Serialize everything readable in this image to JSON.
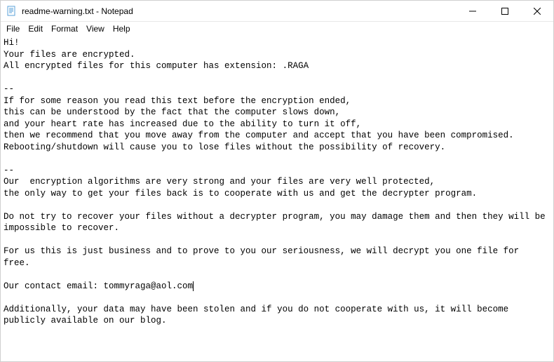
{
  "window": {
    "title": "readme-warning.txt - Notepad",
    "icon": "notepad-icon"
  },
  "menu": {
    "items": [
      "File",
      "Edit",
      "Format",
      "View",
      "Help"
    ]
  },
  "controls": {
    "minimize": "minimize",
    "maximize": "maximize",
    "close": "close"
  },
  "document": {
    "text": "Hi!\nYour files are encrypted.\nAll encrypted files for this computer has extension: .RAGA\n\n--\nIf for some reason you read this text before the encryption ended,\nthis can be understood by the fact that the computer slows down,\nand your heart rate has increased due to the ability to turn it off,\nthen we recommend that you move away from the computer and accept that you have been compromised.\nRebooting/shutdown will cause you to lose files without the possibility of recovery.\n\n--\nOur  encryption algorithms are very strong and your files are very well protected,\nthe only way to get your files back is to cooperate with us and get the decrypter program.\n\nDo not try to recover your files without a decrypter program, you may damage them and then they will be impossible to recover.\n\nFor us this is just business and to prove to you our seriousness, we will decrypt you one file for free.\n\nOur contact email: tommyraga@aol.com\n\nAdditionally, your data may have been stolen and if you do not cooperate with us, it will become publicly available on our blog."
  }
}
